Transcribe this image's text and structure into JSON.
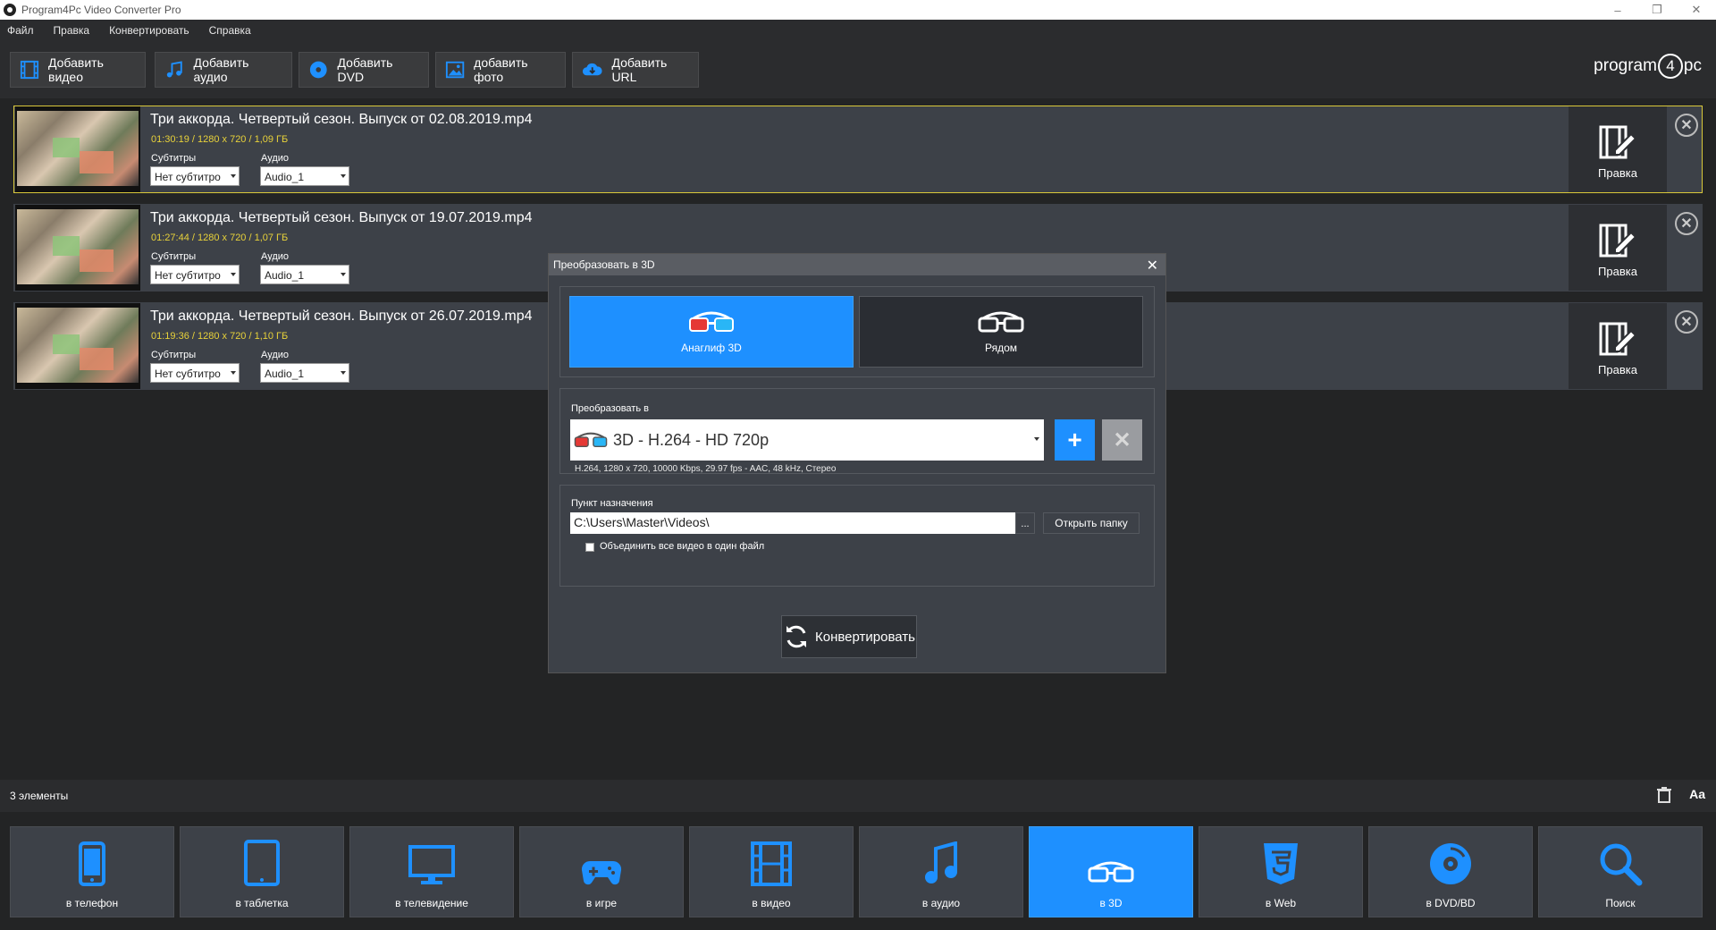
{
  "window": {
    "title": "Program4Pc Video Converter Pro"
  },
  "menu": [
    "Файл",
    "Правка",
    "Конвертировать",
    "Справка"
  ],
  "toolbar": {
    "add_video": "Добавить видео",
    "add_audio": "Добавить аудио",
    "add_dvd": "Добавить DVD",
    "add_photo": "добавить фото",
    "add_url": "Добавить URL",
    "logo_a": "program",
    "logo_b": "4",
    "logo_c": "pc"
  },
  "files": [
    {
      "name": "Три аккорда. Четвертый сезон. Выпуск от 02.08.2019.mp4",
      "meta": "01:30:19   /   1280 x 720   /   1,09 ГБ",
      "subtitles_label": "Субтитры",
      "subtitles_value": "Нет субтитро",
      "audio_label": "Аудио",
      "audio_value": "Audio_1",
      "edit_label": "Правка",
      "selected": true
    },
    {
      "name": "Три аккорда. Четвертый сезон. Выпуск от 19.07.2019.mp4",
      "meta": "01:27:44   /   1280 x 720   /   1,07 ГБ",
      "subtitles_label": "Субтитры",
      "subtitles_value": "Нет субтитро",
      "audio_label": "Аудио",
      "audio_value": "Audio_1",
      "edit_label": "Правка",
      "selected": false
    },
    {
      "name": "Три аккорда. Четвертый сезон. Выпуск от 26.07.2019.mp4",
      "meta": "01:19:36   /   1280 x 720   /   1,10 ГБ",
      "subtitles_label": "Субтитры",
      "subtitles_value": "Нет субтитро",
      "audio_label": "Аудио",
      "audio_value": "Audio_1",
      "edit_label": "Правка",
      "selected": false
    }
  ],
  "dialog": {
    "title": "Преобразовать в 3D",
    "mode_anaglyph": "Анаглиф 3D",
    "mode_side": "Рядом",
    "convert_to_label": "Преобразовать в",
    "format_value": "3D - H.264 - HD 720p",
    "format_info": "H.264,  1280 x 720,  10000 Kbps,  29.97 fps  -  AAC,  48 kHz,  Стерео",
    "destination_label": "Пункт назначения",
    "destination_value": "C:\\Users\\Master\\Videos\\",
    "browse": "...",
    "open_folder": "Открыть папку",
    "merge_label": "Объединить все видео в один файл",
    "convert_button": "Конвертировать"
  },
  "status": {
    "count": "3 элементы",
    "font_button": "Aa"
  },
  "categories": [
    {
      "label": "в телефон",
      "icon": "phone-icon"
    },
    {
      "label": "в таблетка",
      "icon": "tablet-icon"
    },
    {
      "label": "в телевидение",
      "icon": "tv-icon"
    },
    {
      "label": "в игре",
      "icon": "gamepad-icon"
    },
    {
      "label": "в видео",
      "icon": "film-icon"
    },
    {
      "label": "в аудио",
      "icon": "music-icon"
    },
    {
      "label": "в 3D",
      "icon": "3d-glasses-icon",
      "active": true
    },
    {
      "label": "в Web",
      "icon": "html5-icon"
    },
    {
      "label": "в DVD/BD",
      "icon": "disc-icon"
    },
    {
      "label": "Поиск",
      "icon": "search-icon"
    }
  ],
  "colors": {
    "accent": "#1e90ff",
    "highlight": "#e8d23a",
    "panel": "#3d4148",
    "background": "#232425"
  }
}
